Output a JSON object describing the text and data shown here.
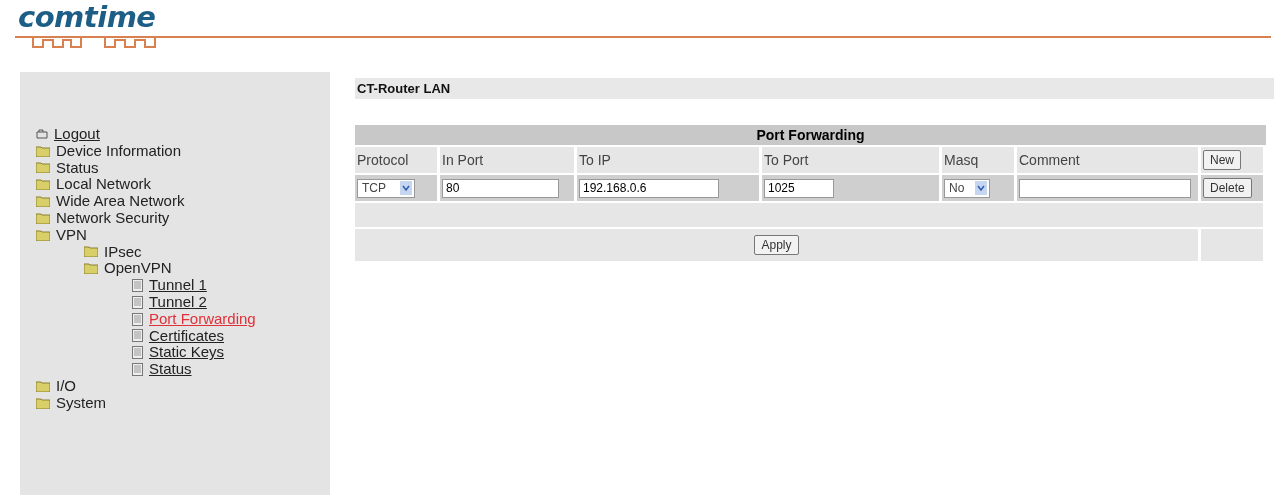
{
  "logo": {
    "text": "comtime"
  },
  "sidebar": {
    "items": [
      {
        "label": "Logout",
        "kind": "logout",
        "selected": false
      },
      {
        "label": "Device Information",
        "kind": "folder",
        "selected": false
      },
      {
        "label": "Status",
        "kind": "folder",
        "selected": false
      },
      {
        "label": "Local Network",
        "kind": "folder",
        "selected": false
      },
      {
        "label": "Wide Area Network",
        "kind": "folder",
        "selected": false
      },
      {
        "label": "Network Security",
        "kind": "folder",
        "selected": false
      },
      {
        "label": "VPN",
        "kind": "folder",
        "selected": false,
        "children": [
          {
            "label": "IPsec",
            "kind": "folder",
            "selected": false
          },
          {
            "label": "OpenVPN",
            "kind": "folder",
            "selected": false,
            "children": [
              {
                "label": "Tunnel 1",
                "kind": "page",
                "selected": false
              },
              {
                "label": "Tunnel 2",
                "kind": "page",
                "selected": false
              },
              {
                "label": "Port Forwarding",
                "kind": "page",
                "selected": true
              },
              {
                "label": "Certificates",
                "kind": "page",
                "selected": false
              },
              {
                "label": "Static Keys",
                "kind": "page",
                "selected": false
              },
              {
                "label": "Status",
                "kind": "page",
                "selected": false
              }
            ]
          }
        ]
      },
      {
        "label": "I/O",
        "kind": "folder",
        "selected": false
      },
      {
        "label": "System",
        "kind": "folder",
        "selected": false
      }
    ]
  },
  "page_title": "CT-Router LAN",
  "table": {
    "title": "Port Forwarding",
    "columns": [
      "Protocol",
      "In Port",
      "To IP",
      "To Port",
      "Masq",
      "Comment"
    ],
    "new_button": "New",
    "rows": [
      {
        "protocol": "TCP",
        "in_port": "80",
        "to_ip": "192.168.0.6",
        "to_port": "1025",
        "masq": "No",
        "delete_button": "Delete"
      }
    ],
    "apply_button": "Apply"
  }
}
